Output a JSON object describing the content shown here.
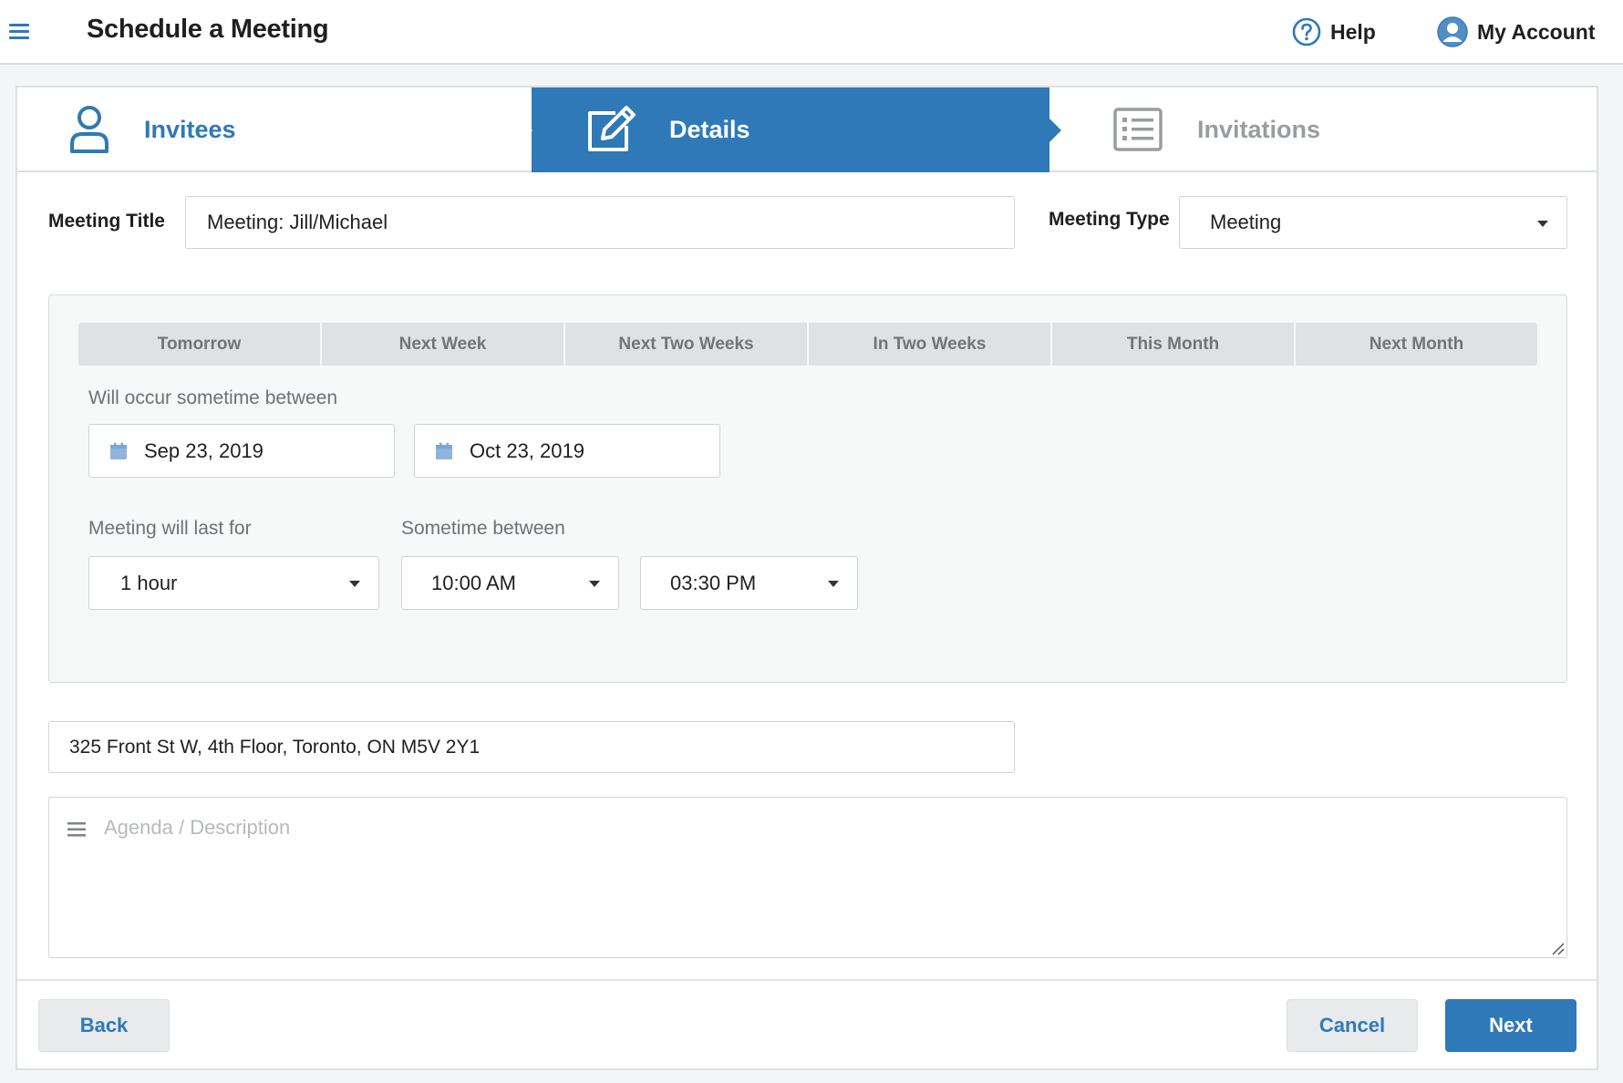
{
  "header": {
    "title": "Schedule a Meeting",
    "help_label": "Help",
    "account_label": "My Account",
    "menu_icon": "hamburger-icon",
    "help_icon": "question-circle-icon",
    "account_icon": "user-avatar-icon"
  },
  "steps": [
    {
      "label": "Invitees",
      "icon": "user-icon",
      "state": "done"
    },
    {
      "label": "Details",
      "icon": "edit-icon",
      "state": "active"
    },
    {
      "label": "Invitations",
      "icon": "list-icon",
      "state": "pending"
    }
  ],
  "form": {
    "title_label": "Meeting Title",
    "title_value": "Meeting: Jill/Michael",
    "type_label": "Meeting Type",
    "type_value": "Meeting"
  },
  "schedule": {
    "quick_ranges": [
      "Tomorrow",
      "Next Week",
      "Next Two Weeks",
      "In Two Weeks",
      "This Month",
      "Next Month"
    ],
    "range_label": "Will occur sometime between",
    "start_date": "Sep 23, 2019",
    "end_date": "Oct 23, 2019",
    "duration_label": "Meeting will last for",
    "duration_value": "1 hour",
    "time_label": "Sometime between",
    "start_time": "10:00 AM",
    "end_time": "03:30 PM"
  },
  "location": {
    "value": "325 Front St W, 4th Floor, Toronto, ON M5V 2Y1"
  },
  "description": {
    "placeholder": "Agenda / Description"
  },
  "footer": {
    "back_label": "Back",
    "cancel_label": "Cancel",
    "next_label": "Next"
  },
  "colors": {
    "accent": "#2f79b8",
    "inactive_step": "#9a9da0",
    "quick_range_bg": "#dfe1e3"
  }
}
